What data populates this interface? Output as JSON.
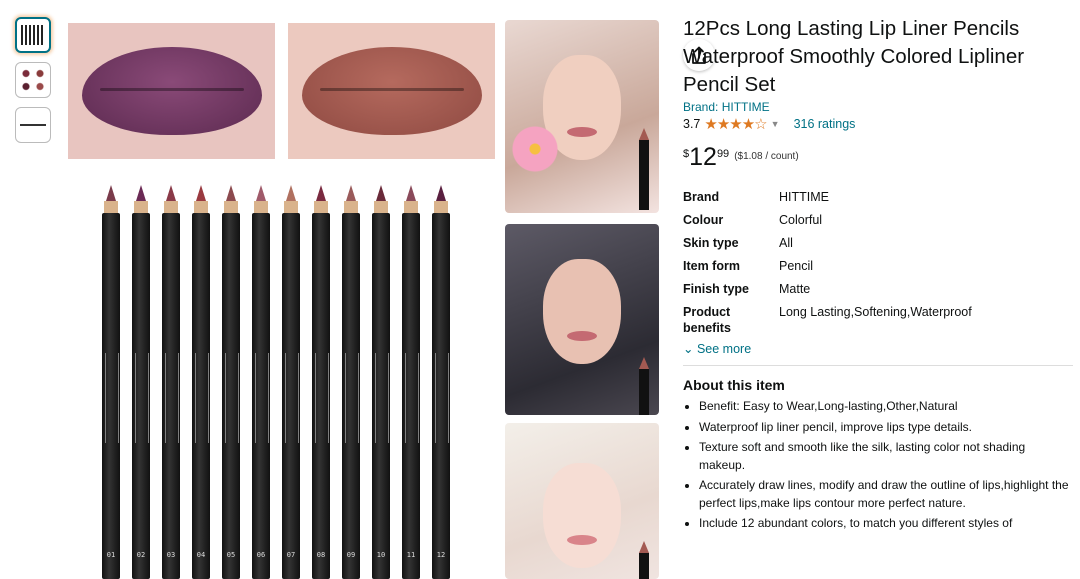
{
  "thumbnails": [
    {
      "name": "thumb-pencils",
      "active": true
    },
    {
      "name": "thumb-lip-grid",
      "active": false
    },
    {
      "name": "thumb-line",
      "active": false
    }
  ],
  "pencil_codes": [
    "01",
    "02",
    "03",
    "04",
    "05",
    "06",
    "07",
    "08",
    "09",
    "10",
    "11",
    "12"
  ],
  "product": {
    "title": "12Pcs Long Lasting Lip Liner Pencils Waterproof Smoothly Colored Lipliner Pencil Set",
    "brand_link": "Brand: HITTIME",
    "rating_value": "3.7",
    "stars": "★★★★☆",
    "ratings_count": "316 ratings",
    "price_symbol": "$",
    "price_whole": "12",
    "price_fraction": "99",
    "unit_price": "($1.08 / count)"
  },
  "specs": [
    {
      "key": "Brand",
      "value": "HITTIME"
    },
    {
      "key": "Colour",
      "value": "Colorful"
    },
    {
      "key": "Skin type",
      "value": "All"
    },
    {
      "key": "Item form",
      "value": "Pencil"
    },
    {
      "key": "Finish type",
      "value": "Matte"
    },
    {
      "key": "Product benefits",
      "value": "Long Lasting,Softening,Waterproof"
    }
  ],
  "see_more": "See more",
  "about": {
    "heading": "About this item",
    "bullets": [
      "Benefit: Easy to Wear,Long-lasting,Other,Natural",
      "Waterproof lip liner pencil, improve lips type details.",
      "Texture soft and smooth like the silk, lasting color not shading makeup.",
      "Accurately draw lines, modify and draw the outline of lips,highlight the perfect lips,make lips contour more perfect nature.",
      "Include 12 abundant colors, to match you different styles of"
    ]
  },
  "colors": {
    "link": "#007185",
    "star": "#de7921",
    "accent": "#e47911"
  },
  "icons": {
    "share": "share-icon",
    "chevron": "chevron-down-icon"
  }
}
